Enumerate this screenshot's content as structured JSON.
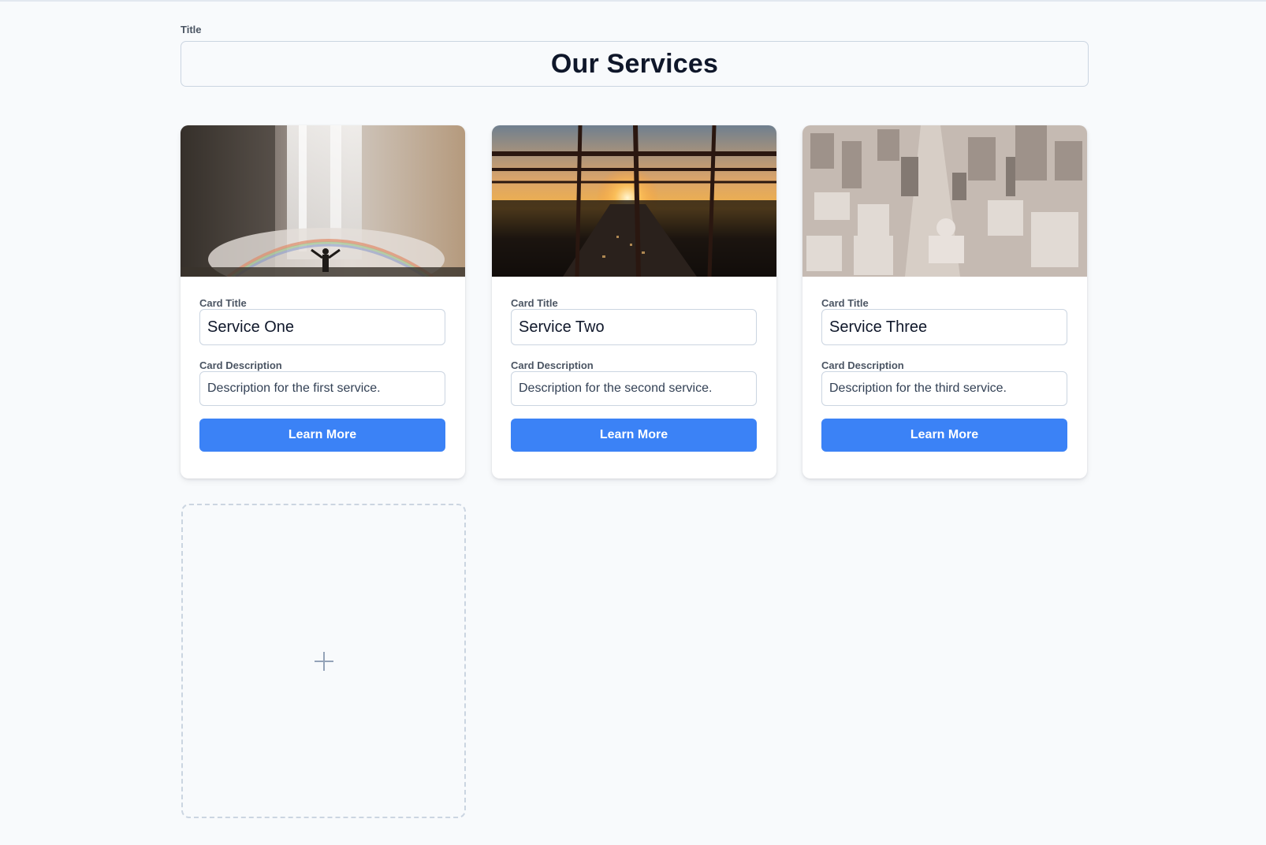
{
  "header": {
    "title_label": "Title",
    "title_value": "Our Services"
  },
  "cards": [
    {
      "image_icon": "waterfall-rainbow-photo",
      "title_label": "Card Title",
      "title_value": "Service One",
      "description_label": "Card Description",
      "description_value": "Description for the first service.",
      "button_label": "Learn More"
    },
    {
      "image_icon": "highway-sunset-photo",
      "title_label": "Card Title",
      "title_value": "Service Two",
      "description_label": "Card Description",
      "description_value": "Description for the second service.",
      "button_label": "Learn More"
    },
    {
      "image_icon": "city-aerial-photo",
      "title_label": "Card Title",
      "title_value": "Service Three",
      "description_label": "Card Description",
      "description_value": "Description for the third service.",
      "button_label": "Learn More"
    }
  ],
  "add_card": {
    "icon": "plus-icon"
  },
  "colors": {
    "accent": "#3b82f6",
    "background": "#f8fafc",
    "border": "#cbd5e1"
  }
}
